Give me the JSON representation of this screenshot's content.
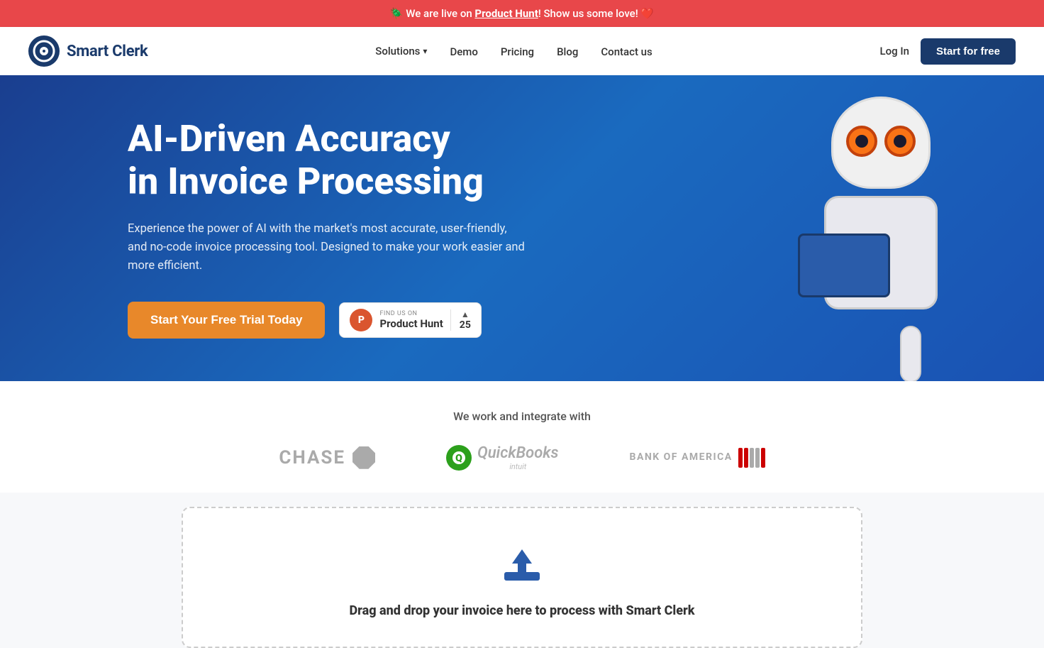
{
  "announcement": {
    "text_before": "🪲 We are live on ",
    "link_text": "Product Hunt",
    "text_after": "! Show us some love! ❤️"
  },
  "navbar": {
    "logo_text": "Smart Clerk",
    "solutions_label": "Solutions",
    "demo_label": "Demo",
    "pricing_label": "Pricing",
    "blog_label": "Blog",
    "contact_label": "Contact us",
    "login_label": "Log In",
    "start_free_label": "Start for free"
  },
  "hero": {
    "title_line1": "AI-Driven Accuracy",
    "title_line2": "in Invoice Processing",
    "subtitle": "Experience the power of AI with the market's most accurate, user-friendly, and no-code invoice processing tool. Designed to make your work easier and more efficient.",
    "trial_btn_label": "Start Your Free Trial Today",
    "ph_find_text": "FIND US ON",
    "ph_name": "Product Hunt",
    "ph_count": "25"
  },
  "integrations": {
    "title": "We work and integrate with",
    "logos": [
      {
        "name": "Chase",
        "type": "chase"
      },
      {
        "name": "QuickBooks",
        "type": "quickbooks"
      },
      {
        "name": "Bank of America",
        "type": "boa"
      }
    ]
  },
  "upload": {
    "text_before": "Drag and drop your invoice here to process with ",
    "brand": "Smart Clerk"
  }
}
